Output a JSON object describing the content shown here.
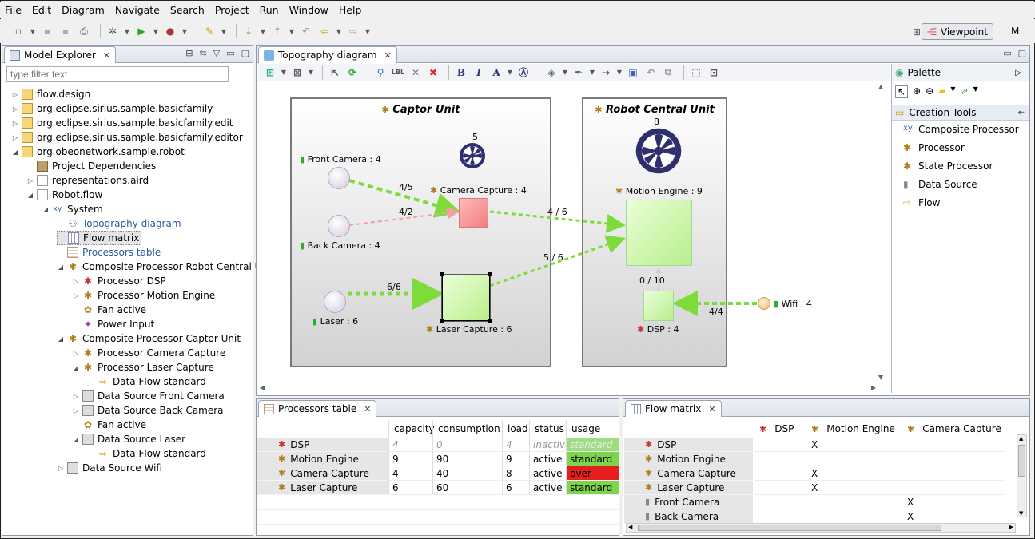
{
  "menu": [
    "File",
    "Edit",
    "Diagram",
    "Navigate",
    "Search",
    "Project",
    "Run",
    "Window",
    "Help"
  ],
  "toolbar": {
    "viewpoint_label": "Viewpoint",
    "overflow_label": "M"
  },
  "model_explorer": {
    "title": "Model Explorer",
    "filter_placeholder": "type filter text",
    "items": [
      {
        "label": "flow.design",
        "depth": 0,
        "tw": "▷",
        "icon": "project-icon"
      },
      {
        "label": "org.eclipse.sirius.sample.basicfamily",
        "depth": 0,
        "tw": "▷",
        "icon": "project-icon"
      },
      {
        "label": "org.eclipse.sirius.sample.basicfamily.edit",
        "depth": 0,
        "tw": "▷",
        "icon": "project-icon"
      },
      {
        "label": "org.eclipse.sirius.sample.basicfamily.editor",
        "depth": 0,
        "tw": "▷",
        "icon": "project-icon"
      },
      {
        "label": "org.obeonetwork.sample.robot",
        "depth": 0,
        "tw": "◢",
        "icon": "project-icon"
      },
      {
        "label": "Project Dependencies",
        "depth": 1,
        "tw": "",
        "icon": "dependencies-icon"
      },
      {
        "label": "representations.aird",
        "depth": 1,
        "tw": "▷",
        "icon": "aird-file-icon"
      },
      {
        "label": "Robot.flow",
        "depth": 1,
        "tw": "◢",
        "icon": "flow-file-icon"
      },
      {
        "label": "System",
        "depth": 2,
        "tw": "◢",
        "icon": "system-icon"
      },
      {
        "label": "Topography diagram",
        "depth": 3,
        "tw": "",
        "icon": "diagram-icon",
        "link": true
      },
      {
        "label": "Flow matrix",
        "depth": 3,
        "tw": "",
        "icon": "matrix-icon",
        "selected": true
      },
      {
        "label": "Processors table",
        "depth": 3,
        "tw": "",
        "icon": "table-icon",
        "link": true
      },
      {
        "label": "Composite Processor Robot Central Un",
        "depth": 3,
        "tw": "◢",
        "icon": "composite-processor-icon"
      },
      {
        "label": "Processor DSP",
        "depth": 4,
        "tw": "▷",
        "icon": "processor-red-icon"
      },
      {
        "label": "Processor Motion Engine",
        "depth": 4,
        "tw": "▷",
        "icon": "processor-icon"
      },
      {
        "label": "Fan active",
        "depth": 4,
        "tw": "",
        "icon": "fan-icon"
      },
      {
        "label": "Power Input",
        "depth": 4,
        "tw": "",
        "icon": "power-icon"
      },
      {
        "label": "Composite Processor Captor Unit",
        "depth": 3,
        "tw": "◢",
        "icon": "composite-processor-icon"
      },
      {
        "label": "Processor Camera Capture",
        "depth": 4,
        "tw": "▷",
        "icon": "processor-icon"
      },
      {
        "label": "Processor Laser Capture",
        "depth": 4,
        "tw": "◢",
        "icon": "processor-icon"
      },
      {
        "label": "Data Flow standard",
        "depth": 5,
        "tw": "",
        "icon": "flow-arrow-icon"
      },
      {
        "label": "Data Source Front Camera",
        "depth": 4,
        "tw": "▷",
        "icon": "data-source-icon"
      },
      {
        "label": "Data Source Back Camera",
        "depth": 4,
        "tw": "▷",
        "icon": "data-source-icon"
      },
      {
        "label": "Fan active",
        "depth": 4,
        "tw": "",
        "icon": "fan-icon"
      },
      {
        "label": "Data Source Laser",
        "depth": 4,
        "tw": "◢",
        "icon": "data-source-icon"
      },
      {
        "label": "Data Flow standard",
        "depth": 5,
        "tw": "",
        "icon": "flow-arrow-icon"
      },
      {
        "label": "Data Source Wifi",
        "depth": 3,
        "tw": "▷",
        "icon": "data-source-icon"
      }
    ]
  },
  "diagram": {
    "tab_title": "Topography diagram",
    "captor_unit": {
      "title": "Captor Unit",
      "fan_count": "5"
    },
    "robot_unit": {
      "title": "Robot Central Unit",
      "fan_count": "8"
    },
    "nodes": {
      "front_camera": "Front Camera : 4",
      "back_camera": "Back Camera : 4",
      "laser": "Laser : 6",
      "camera_capture": "Camera Capture : 4",
      "laser_capture": "Laser Capture : 6",
      "motion_engine": "Motion Engine : 9",
      "dsp": "DSP : 4",
      "wifi": "Wifi : 4"
    },
    "edges": {
      "front_to_camera": "4/5",
      "back_to_camera": "4/2",
      "camera_to_motion": "4 / 6",
      "laser_to_capture": "6/6",
      "capture_to_motion": "5 / 6",
      "dsp_to_motion": "0 / 10",
      "wifi_to_dsp": "4/4"
    },
    "colors": {
      "flow_ok": "#7ddc3a",
      "flow_warn": "#f4a0a0",
      "node_ok": "#ccf7a8",
      "node_over": "#f59a9a"
    }
  },
  "palette": {
    "title": "Palette",
    "section": "Creation Tools",
    "items": [
      "Composite Processor",
      "Processor",
      "State Processor",
      "Data Source",
      "Flow"
    ]
  },
  "processors_table": {
    "title": "Processors table",
    "columns": [
      "capacity",
      "consumption",
      "load",
      "status",
      "usage"
    ],
    "rows": [
      {
        "name": "DSP",
        "capacity": "4",
        "consumption": "0",
        "load": "4",
        "status": "inactive",
        "usage": "standard",
        "inactive": true
      },
      {
        "name": "Motion Engine",
        "capacity": "9",
        "consumption": "90",
        "load": "9",
        "status": "active",
        "usage": "standard"
      },
      {
        "name": "Camera Capture",
        "capacity": "4",
        "consumption": "40",
        "load": "8",
        "status": "active",
        "usage": "over"
      },
      {
        "name": "Laser Capture",
        "capacity": "6",
        "consumption": "60",
        "load": "6",
        "status": "active",
        "usage": "standard"
      }
    ]
  },
  "flow_matrix": {
    "title": "Flow matrix",
    "columns": [
      "DSP",
      "Motion Engine",
      "Camera Capture"
    ],
    "rows": [
      {
        "name": "DSP",
        "cells": [
          "",
          "X",
          ""
        ]
      },
      {
        "name": "Motion Engine",
        "cells": [
          "",
          "",
          ""
        ]
      },
      {
        "name": "Camera Capture",
        "cells": [
          "",
          "X",
          ""
        ]
      },
      {
        "name": "Laser Capture",
        "cells": [
          "",
          "X",
          ""
        ]
      },
      {
        "name": "Front Camera",
        "cells": [
          "",
          "",
          "X"
        ]
      },
      {
        "name": "Back Camera",
        "cells": [
          "",
          "",
          "X"
        ]
      }
    ]
  }
}
